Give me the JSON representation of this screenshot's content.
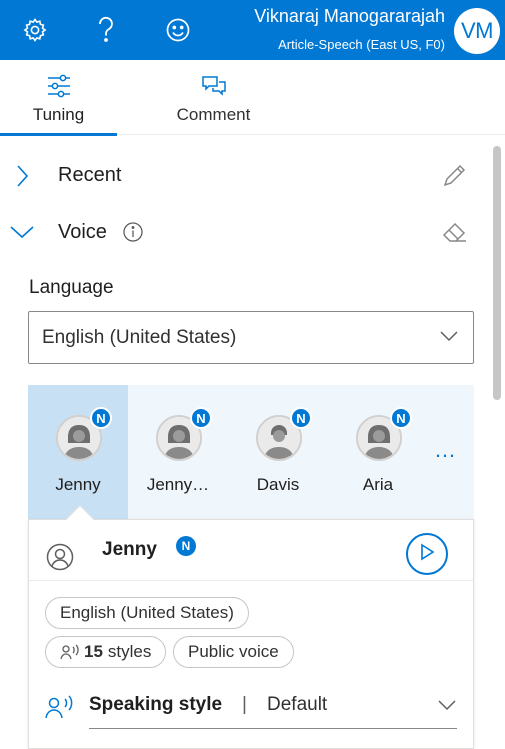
{
  "header": {
    "user_name": "Viknaraj Manogararajah",
    "resource": "Article-Speech (East US, F0)",
    "avatar_initials": "VM",
    "icons": [
      "gear-icon",
      "help-icon",
      "smiley-icon"
    ],
    "background_color": "#0078d4"
  },
  "tabs": [
    {
      "label": "Tuning",
      "icon": "sliders-icon",
      "active": true
    },
    {
      "label": "Comment",
      "icon": "comment-icon",
      "active": false
    }
  ],
  "sections": {
    "recent": {
      "title": "Recent",
      "expanded": false,
      "action_icon": "pencil-icon"
    },
    "voice": {
      "title": "Voice",
      "expanded": true,
      "info_icon": "info-icon",
      "action_icon": "eraser-icon"
    }
  },
  "language": {
    "label": "Language",
    "selected": "English (United States)"
  },
  "voices": [
    {
      "name": "Jenny",
      "badge": "N",
      "selected": true
    },
    {
      "name": "Jenny…",
      "badge": "N",
      "selected": false
    },
    {
      "name": "Davis",
      "badge": "N",
      "selected": false
    },
    {
      "name": "Aria",
      "badge": "N",
      "selected": false
    }
  ],
  "more_label": "…",
  "detail": {
    "name": "Jenny",
    "badge": "N",
    "language_tag": "English (United States)",
    "styles_count": "15",
    "styles_label": "styles",
    "voice_type": "Public voice",
    "speaking_style_label": "Speaking style",
    "separator": "|",
    "speaking_style_value": "Default"
  },
  "accent_color": "#0078d4"
}
